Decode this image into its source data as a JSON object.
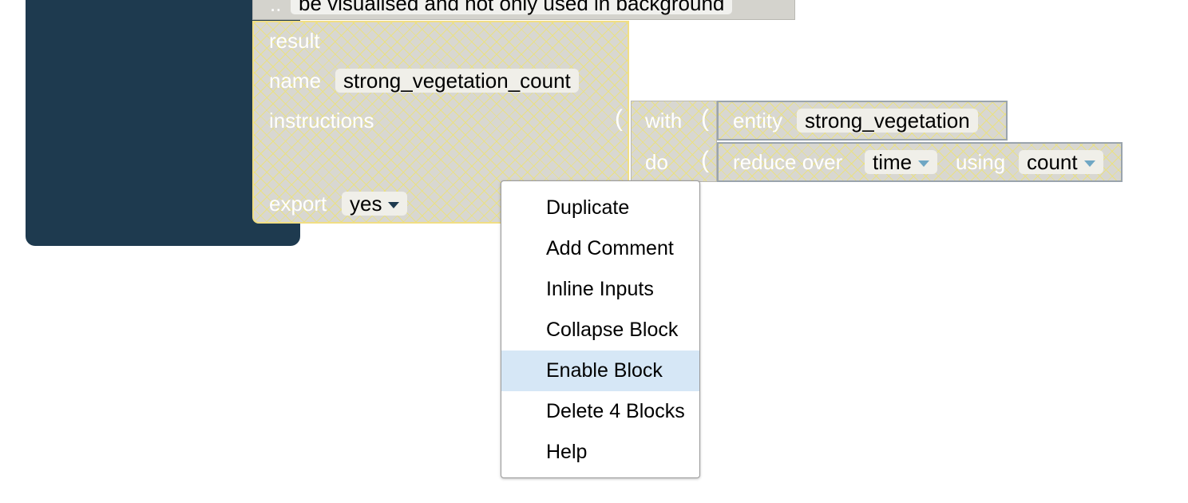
{
  "top_block": {
    "dots": "..",
    "comment": "be visualised and not only used in background"
  },
  "result_block": {
    "title": "result",
    "name_label": "name",
    "name_value": "strong_vegetation_count",
    "instructions_label": "instructions",
    "export_label": "export",
    "export_value": "yes"
  },
  "with_do_block": {
    "with_label": "with",
    "do_label": "do"
  },
  "entity_block": {
    "label": "entity",
    "value": "strong_vegetation"
  },
  "reduce_block": {
    "label": "reduce over",
    "over_value": "time",
    "using_label": "using",
    "using_value": "count"
  },
  "context_menu": {
    "items": [
      {
        "label": "Duplicate"
      },
      {
        "label": "Add Comment"
      },
      {
        "label": "Inline Inputs"
      },
      {
        "label": "Collapse Block"
      },
      {
        "label": "Enable Block"
      },
      {
        "label": "Delete 4 Blocks"
      },
      {
        "label": "Help"
      }
    ]
  },
  "colors": {
    "workspace_panel": "#1e3a4f",
    "disabled_hatch": "#ece278",
    "selection_outline": "#f1de84",
    "menu_highlight": "#d6e7f6",
    "dropdown_arrow": "#6fa7c4"
  },
  "icons": {
    "dropdown": "triangle-down-icon",
    "connector": "puzzle-notch-icon"
  }
}
